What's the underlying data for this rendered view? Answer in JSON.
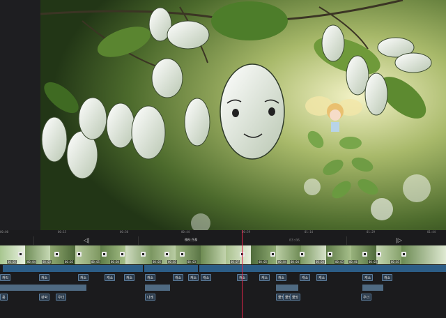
{
  "ruler_ticks": [
    "00:00",
    "00:15",
    "00:30",
    "00:44",
    "00:59",
    "01:14",
    "01:29",
    "01:44"
  ],
  "transport": {
    "prev_icon": "skip-back-icon",
    "current_time": "00:59",
    "total_time": "03:06",
    "next_icon": "skip-forward-icon"
  },
  "durations": [
    "00:05",
    "00:04",
    "00:03",
    "00:03",
    "00:05",
    "00:04",
    "00:05",
    "00:03",
    "00:03",
    "00:07",
    "00:05",
    "00:04",
    "00:04",
    "00:04",
    "00:03",
    "00:06",
    "00:02",
    "00:03"
  ],
  "subtitles": {
    "row1": [
      "캐릭",
      "캐소",
      "캐소",
      "캐소",
      "캐소",
      "캐소",
      "캐소",
      "캐소",
      "캐소",
      "캐소",
      "캐소",
      "캐소",
      "캐소",
      "캐소",
      "캐소",
      "캐소"
    ],
    "row2": [
      "용",
      "판박",
      "우더",
      "나레",
      "물방",
      "물방",
      "물방",
      "우더"
    ]
  },
  "colors": {
    "accent": "#e0254a",
    "audio": "#2c5d86",
    "bar": "#4f6a82"
  }
}
